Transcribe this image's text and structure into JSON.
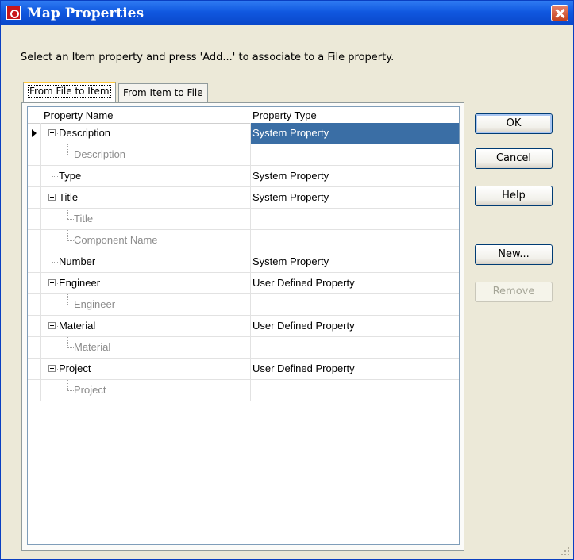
{
  "window": {
    "title": "Map Properties",
    "app_icon": "app-logo-icon",
    "close_icon": "close-icon"
  },
  "instruction": "Select an Item property and press 'Add...' to associate to a File property.",
  "tabs": [
    {
      "label": "From File to Item",
      "active": true
    },
    {
      "label": "From Item to File",
      "active": false
    }
  ],
  "grid": {
    "columns": [
      "Property Name",
      "Property Type"
    ],
    "rows": [
      {
        "name": "Description",
        "type": "System Property",
        "level": 0,
        "expandable": true,
        "selected": true,
        "current": true
      },
      {
        "name": "Description",
        "type": "",
        "level": 1,
        "expandable": false
      },
      {
        "name": "Type",
        "type": "System Property",
        "level": 0,
        "expandable": false
      },
      {
        "name": "Title",
        "type": "System Property",
        "level": 0,
        "expandable": true
      },
      {
        "name": "Title",
        "type": "",
        "level": 1,
        "expandable": false
      },
      {
        "name": "Component Name",
        "type": "",
        "level": 1,
        "expandable": false
      },
      {
        "name": "Number",
        "type": "System Property",
        "level": 0,
        "expandable": false
      },
      {
        "name": "Engineer",
        "type": "User Defined Property",
        "level": 0,
        "expandable": true
      },
      {
        "name": "Engineer",
        "type": "",
        "level": 1,
        "expandable": false
      },
      {
        "name": "Material",
        "type": "User Defined Property",
        "level": 0,
        "expandable": true
      },
      {
        "name": "Material",
        "type": "",
        "level": 1,
        "expandable": false
      },
      {
        "name": "Project",
        "type": "User Defined Property",
        "level": 0,
        "expandable": true
      },
      {
        "name": "Project",
        "type": "",
        "level": 1,
        "expandable": false
      }
    ]
  },
  "buttons": {
    "ok": "OK",
    "cancel": "Cancel",
    "help": "Help",
    "new": "New...",
    "remove": "Remove"
  },
  "colors": {
    "titlebar": "#0947c9",
    "selection": "#3a6ea5",
    "tab_highlight": "#ffc83c"
  }
}
